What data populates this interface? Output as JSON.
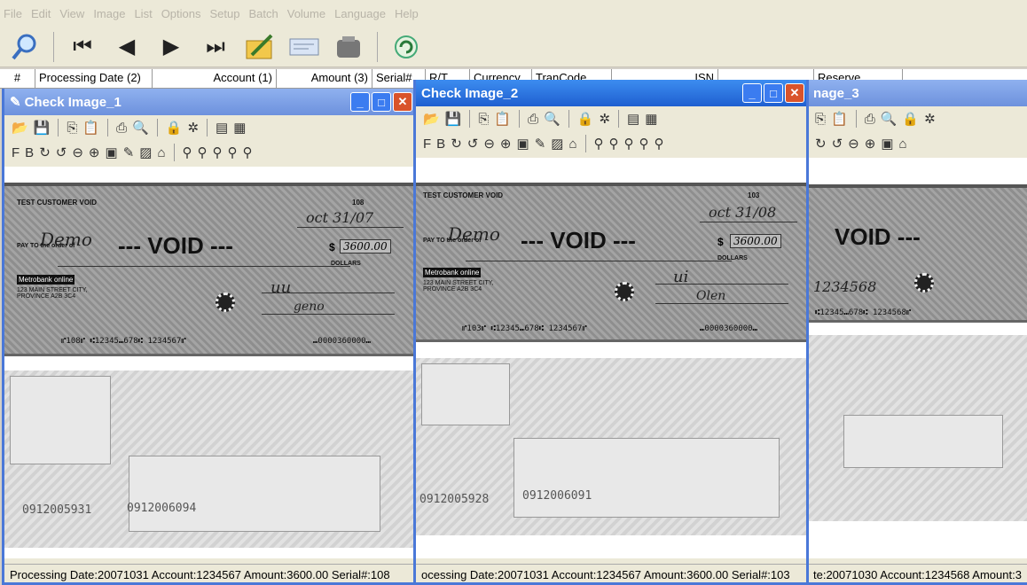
{
  "menu": [
    "File",
    "Edit",
    "View",
    "Image",
    "List",
    "Options",
    "Setup",
    "Batch",
    "Volume",
    "Language",
    "Help"
  ],
  "columns": [
    "#",
    "Processing Date (2)",
    "Account (1)",
    "Amount (3)",
    "Serial#",
    "R/T",
    "Currency",
    "TranCode",
    "ISN",
    "",
    "Reserve"
  ],
  "windows": [
    {
      "title": "Check Image_1",
      "check": {
        "customer": "TEST CUSTOMER VOID",
        "number": "108",
        "date": "oct 31/07",
        "payee": "Demo",
        "void": "--- VOID ---",
        "amount": "3600.00",
        "dollars": "DOLLARS",
        "bank": "Metrobank online",
        "address": "123 MAIN STREET CITY, PROVINCE A2B 3C4",
        "micr": "⑈108⑈ ⑆12345⑉678⑆ 1234567⑈",
        "micr_amount": "⑉0000360000⑉"
      },
      "back_numbers": [
        "0912005931",
        "0912006094"
      ],
      "status": "Processing Date:20071031 Account:1234567 Amount:3600.00 Serial#:108"
    },
    {
      "title": "Check Image_2",
      "check": {
        "customer": "TEST CUSTOMER VOID",
        "number": "103",
        "date": "oct 31/08",
        "payee": "Demo",
        "void": "--- VOID ---",
        "amount": "3600.00",
        "dollars": "DOLLARS",
        "bank": "Metrobank online",
        "address": "123 MAIN STREET CITY, PROVINCE A2B 3C4",
        "micr": "⑈103⑈ ⑆12345⑉678⑆ 1234567⑈",
        "micr_amount": "⑉0000360000⑉"
      },
      "back_numbers": [
        "0912005928",
        "0912006091"
      ],
      "status": "ocessing Date:20071031 Account:1234567 Amount:3600.00 Serial#:103"
    },
    {
      "title": "nage_3",
      "check": {
        "void": "VOID ---",
        "account_hand": "1234568",
        "micr": "⑆12345⑉678⑆ 1234568⑈"
      },
      "status": "te:20071030 Account:1234568 Amount:3"
    }
  ]
}
